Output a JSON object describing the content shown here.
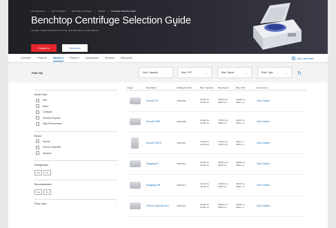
{
  "breadcrumbs": [
    "Lab Equipment",
    "Lab Centrifuges",
    "Benchtop Centrifuges",
    "Models",
    "Centrifuge Selection Guide"
  ],
  "hero": {
    "title": "Benchtop Centrifuge Selection Guide",
    "subtitle": "Versatile, reliable workhorses of the lab, high capacities in small footprints.",
    "contact_label": "Contact us",
    "demo_label": "View demo"
  },
  "tabs": [
    {
      "label": "Overview"
    },
    {
      "label": "Features"
    },
    {
      "label": "Models",
      "active": true
    },
    {
      "label": "Rotors"
    },
    {
      "label": "Accessories"
    },
    {
      "label": "Services"
    },
    {
      "label": "Resources"
    }
  ],
  "specialist_label": "Ask a specialist",
  "filter_label": "Filter By",
  "filters": [
    "Max. Capacity",
    "Max. RCF",
    "Max. Speed",
    "Rotor Type"
  ],
  "sidebar": [
    {
      "title": "Model Type",
      "options": [
        "Mini",
        "Micro",
        "Compact",
        "General Purpose",
        "High Performance"
      ]
    },
    {
      "title": "Brand",
      "options": [
        "Sorvall",
        "Thermo Scientific",
        "Heraeus"
      ]
    },
    {
      "title": "Refrigerated",
      "yesno": [
        "Yes",
        "No"
      ]
    },
    {
      "title": "Biocontainment",
      "yesno": [
        "Yes",
        "No"
      ]
    },
    {
      "title": "Rotor Type"
    }
  ],
  "table": {
    "headers": [
      "Image",
      "Description",
      "Catalog Number",
      "Max. Capacity",
      "Max Speed",
      "Max. RCF",
      "Accessories"
    ],
    "rows": [
      {
        "desc": "Sorvall ST8",
        "cat": "75007200",
        "cap": [
          "4x100 mL",
          "4x145 mL"
        ],
        "speed": [
          "15000 rpm",
          "4500 rpm"
        ],
        "rcf": [
          "24328 x g",
          "3260 x g"
        ],
        "link": "View Details ›"
      },
      {
        "desc": "Sorvall ST8R",
        "cat": "75007205",
        "cap": [
          "4x100 mL",
          "4x145 mL"
        ],
        "speed": [
          "17000 rpm",
          "4500 rpm"
        ],
        "rcf": [
          "30279 x g",
          "3260 x g"
        ],
        "link": "View Details ›"
      },
      {
        "desc": "Sorvall ST8FR",
        "cat": "75007207",
        "cap": [
          "4x100 mL",
          "4x145 mL"
        ],
        "speed": [
          "17000 rpm",
          "15379 rpm"
        ],
        "rcf": [
          "4500 x g",
          "3260 x g"
        ],
        "link": "View Details ›"
      },
      {
        "desc": "Megafuge 8",
        "cat": "75007210",
        "cap": [
          "4x100 mL",
          "4x145 mL"
        ],
        "speed": [
          "15000 rpm",
          "4500 rpm"
        ],
        "rcf": [
          "24328 x g",
          "3260 x g"
        ],
        "link": "View Details ›"
      },
      {
        "desc": "Megafuge 8R",
        "cat": "75007213",
        "cap": [
          "4x100 mL",
          "4x145 mL"
        ],
        "speed": [
          "17000 rpm",
          "4500 rpm"
        ],
        "rcf": [
          "30279 x g",
          "3260 x g"
        ],
        "link": "View Details ›"
      },
      {
        "desc": "Thermo Scientific 8x4",
        "cat": "75007224",
        "cap": [
          "4x100 mL",
          "4x145 mL"
        ],
        "speed": [
          "15000 rpm",
          "4500 rpm"
        ],
        "rcf": [
          "24328 x g",
          "3260 x g"
        ],
        "link": "View Details ›"
      }
    ]
  }
}
